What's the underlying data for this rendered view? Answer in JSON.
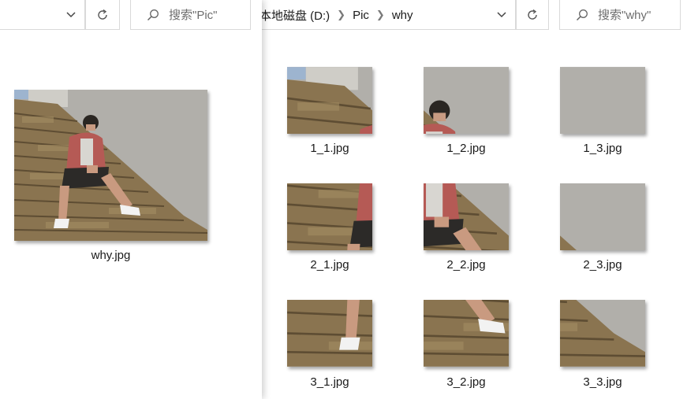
{
  "left_window": {
    "search_placeholder": "搜索\"Pic\"",
    "file": {
      "name": "why.jpg"
    }
  },
  "right_window": {
    "breadcrumb": {
      "drive": "本地磁盘 (D:)",
      "folder1": "Pic",
      "folder2": "why"
    },
    "search_placeholder": "搜索\"why\"",
    "files": [
      {
        "name": "1_1.jpg"
      },
      {
        "name": "1_2.jpg"
      },
      {
        "name": "1_3.jpg"
      },
      {
        "name": "2_1.jpg"
      },
      {
        "name": "2_2.jpg"
      },
      {
        "name": "2_3.jpg"
      },
      {
        "name": "3_1.jpg"
      },
      {
        "name": "3_2.jpg"
      },
      {
        "name": "3_3.jpg"
      }
    ]
  },
  "icons": {
    "dropdown": "chevron-down-icon",
    "refresh": "refresh-icon",
    "search": "search-icon",
    "separator": "chevron-right-icon"
  }
}
